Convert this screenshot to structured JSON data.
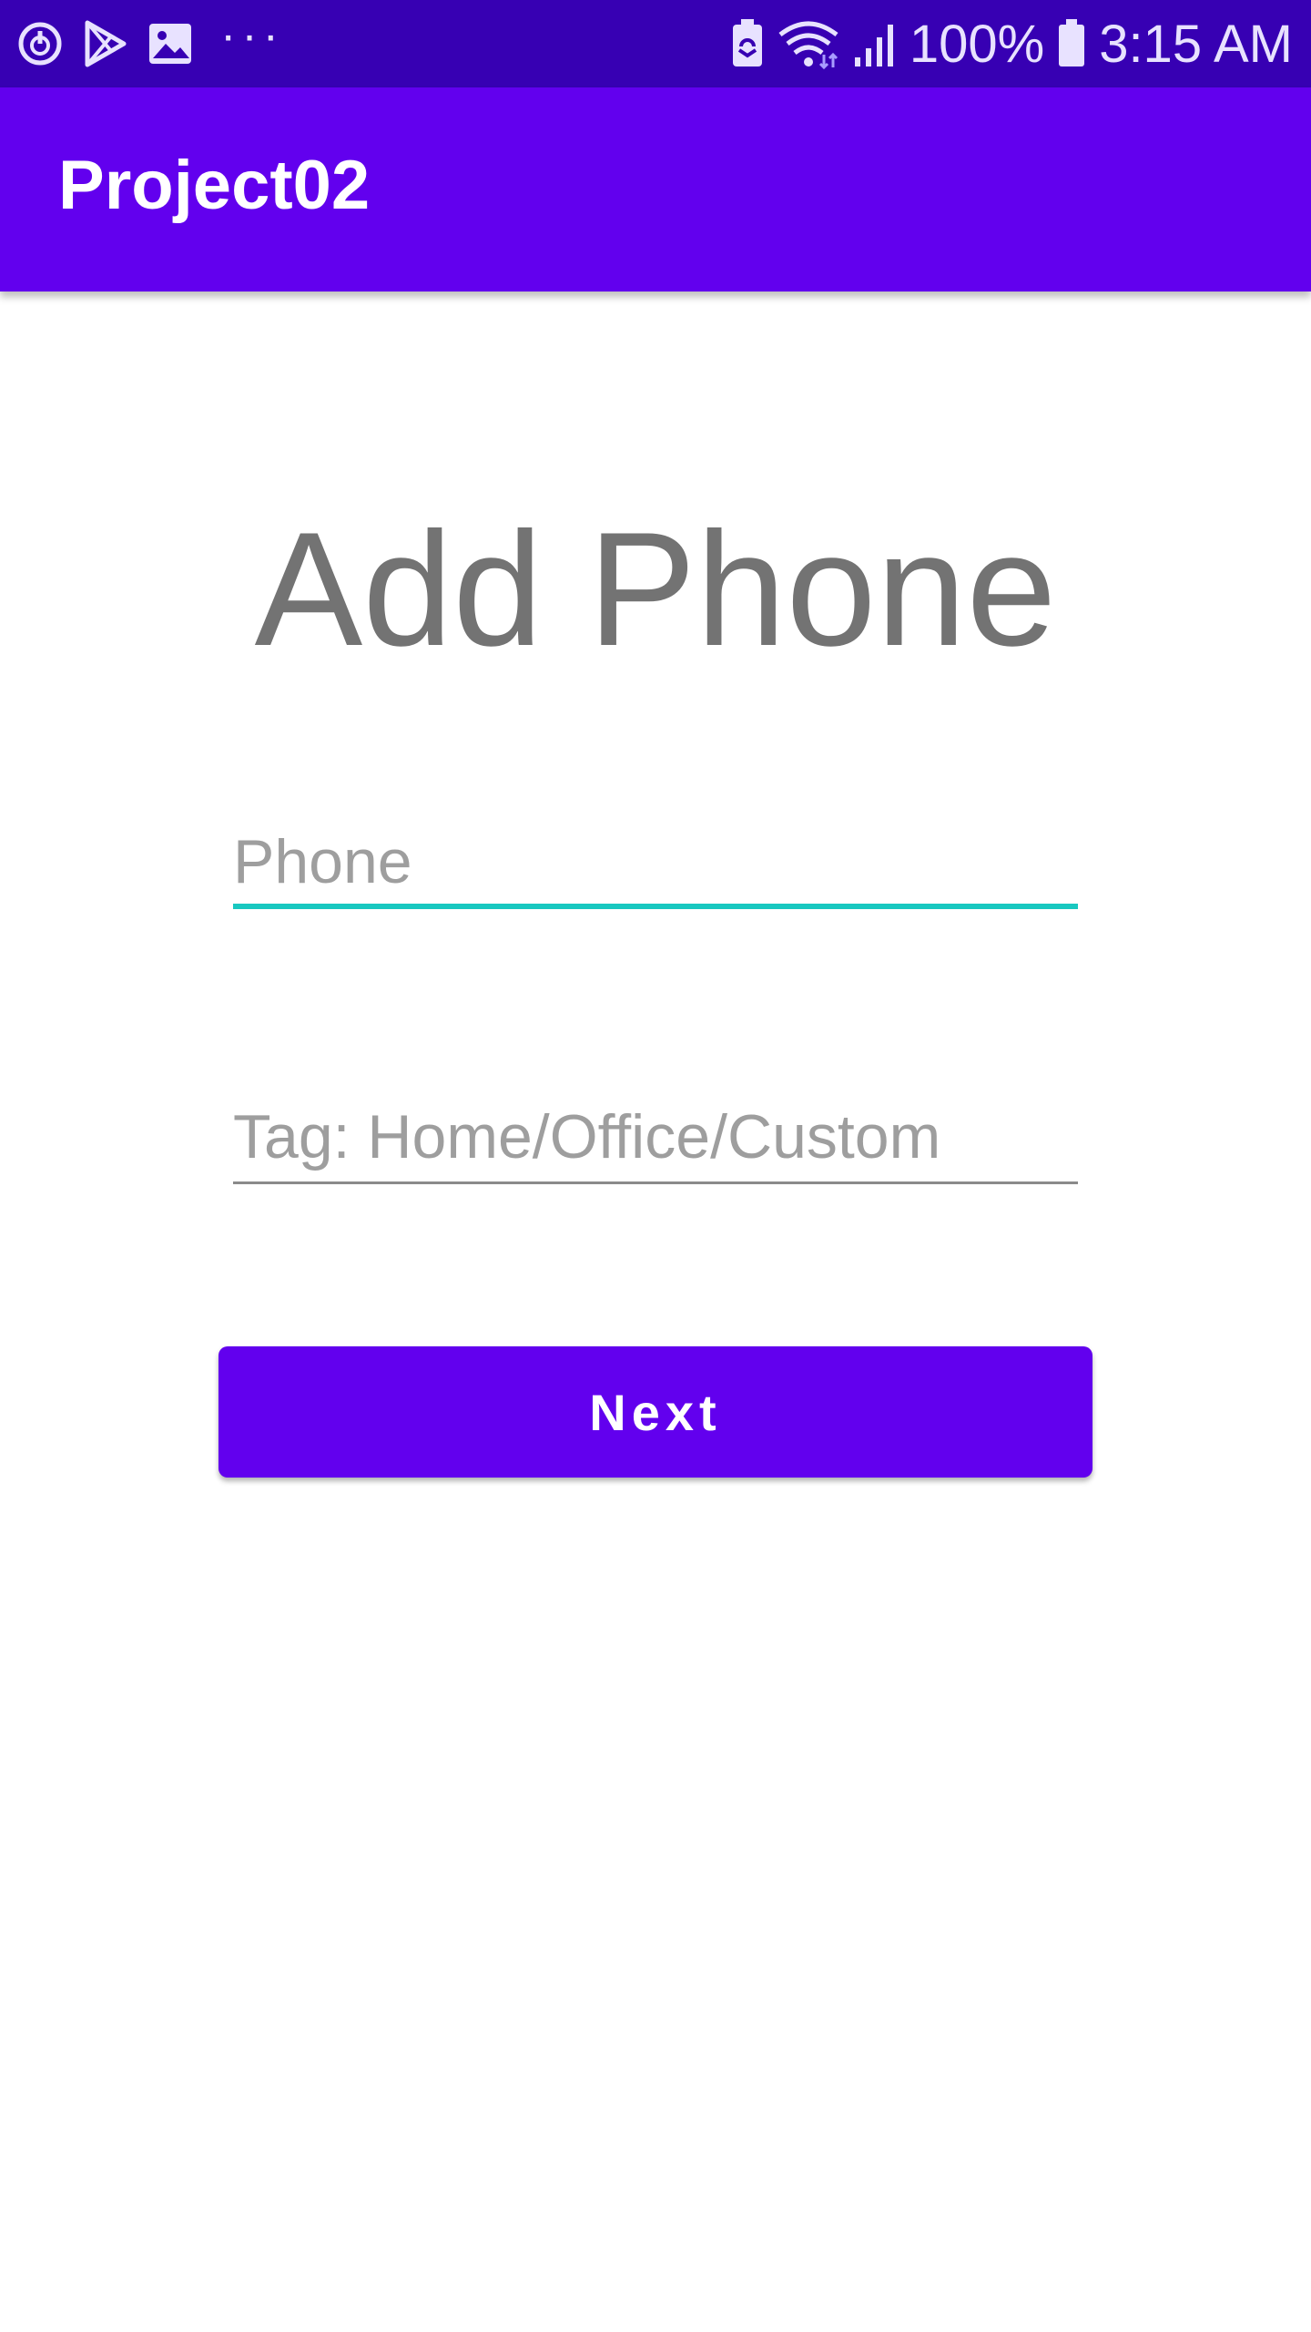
{
  "status_bar": {
    "left_icons": [
      "sync-power-icon",
      "play-store-icon",
      "gallery-icon",
      "more-dots-icon"
    ],
    "more_label": "···",
    "right_icons": [
      "battery-saver-icon",
      "wifi-icon",
      "signal-icon",
      "battery-icon"
    ],
    "battery_percent": "100%",
    "time": "3:15 AM"
  },
  "app_bar": {
    "title": "Project02"
  },
  "main": {
    "heading": "Add Phone",
    "phone_field": {
      "value": "",
      "placeholder": "Phone"
    },
    "tag_field": {
      "value": "",
      "placeholder": "Tag: Home/Office/Custom"
    },
    "next_label": "Next"
  },
  "colors": {
    "status_bar": "#3700b3",
    "primary": "#6200ee",
    "accent": "#18c8c0",
    "heading_text": "#737373",
    "hint_text": "#9e9e9e"
  }
}
